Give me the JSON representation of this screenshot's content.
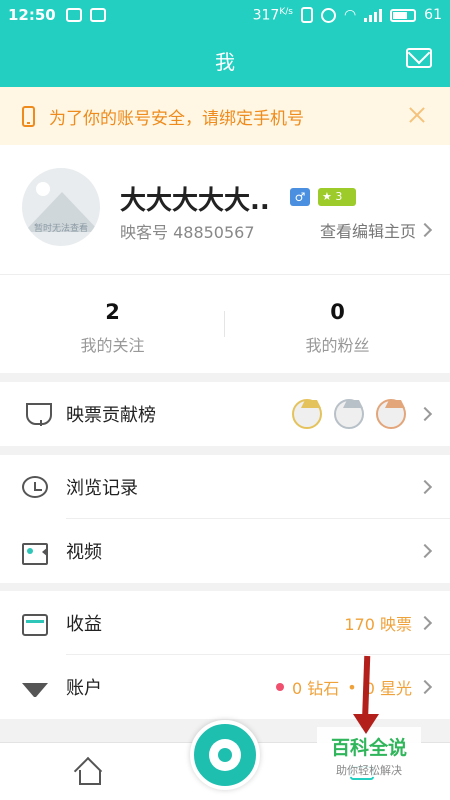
{
  "status_bar": {
    "time": "12:50",
    "speed": "317",
    "speed_unit": "K/s",
    "battery": "61"
  },
  "header": {
    "title": "我"
  },
  "banner": {
    "text": "为了你的账号安全，请绑定手机号"
  },
  "profile": {
    "username": "大大大大大..",
    "gender_symbol": "♂",
    "level": "3",
    "user_id": "映客号 48850567",
    "avatar_text": "暂时无法查看",
    "edit_link": "查看编辑主页"
  },
  "stats": [
    {
      "value": "2",
      "label": "我的关注"
    },
    {
      "value": "0",
      "label": "我的粉丝"
    }
  ],
  "menu": {
    "ranking": "映票贡献榜",
    "history": "浏览记录",
    "video": "视频",
    "income": {
      "label": "收益",
      "value": "170 映票"
    },
    "account": {
      "label": "账户",
      "diamonds": "0 钻石",
      "stars": "0 星光"
    }
  },
  "watermark": {
    "title": "百科全说",
    "subtitle": "助你轻松解决"
  },
  "colors": {
    "accent": "#22cfc0",
    "warning": "#ee8b1c",
    "income_value": "#f0a23a"
  }
}
